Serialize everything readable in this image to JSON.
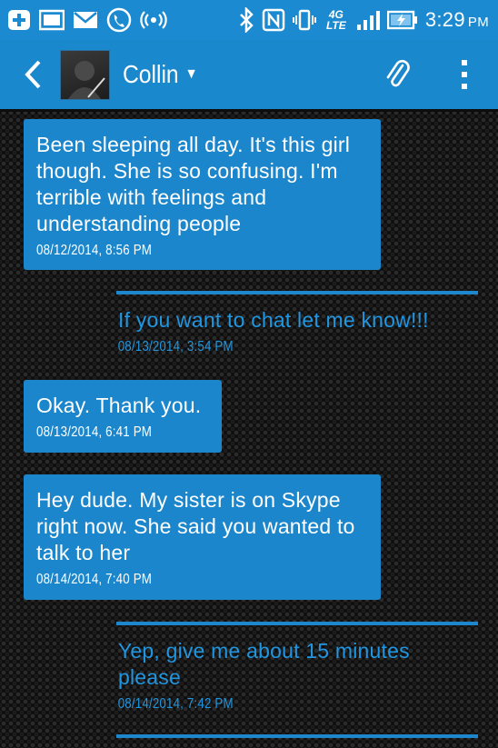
{
  "status_bar": {
    "time": "3:29",
    "ampm": "PM",
    "network_type": "4G LTE",
    "icons": [
      "add-notification-icon",
      "gallery-icon",
      "mail-icon",
      "phone-call-icon",
      "hotspot-icon",
      "bluetooth-icon",
      "nfc-icon",
      "vibrate-icon",
      "signal-icon",
      "battery-charging-icon"
    ]
  },
  "header": {
    "contact_name": "Collin",
    "accent_color": "#1a88cd"
  },
  "messages": [
    {
      "direction": "incoming",
      "text": "Been sleeping all day. It's this girl though. She is so confusing. I'm terrible with feelings and understanding people",
      "time": "08/12/2014, 8:56 PM"
    },
    {
      "direction": "outgoing",
      "text": "If you want to chat let me know!!!",
      "time": "08/13/2014, 3:54 PM"
    },
    {
      "direction": "incoming",
      "text": "Okay. Thank you.",
      "time": "08/13/2014, 6:41 PM"
    },
    {
      "direction": "incoming",
      "text": "Hey dude. My sister is on Skype right now. She said you wanted to talk to her",
      "time": "08/14/2014, 7:40 PM"
    },
    {
      "direction": "outgoing",
      "text": "Yep, give me about 15 minutes please",
      "time": "08/14/2014, 7:42 PM"
    }
  ]
}
